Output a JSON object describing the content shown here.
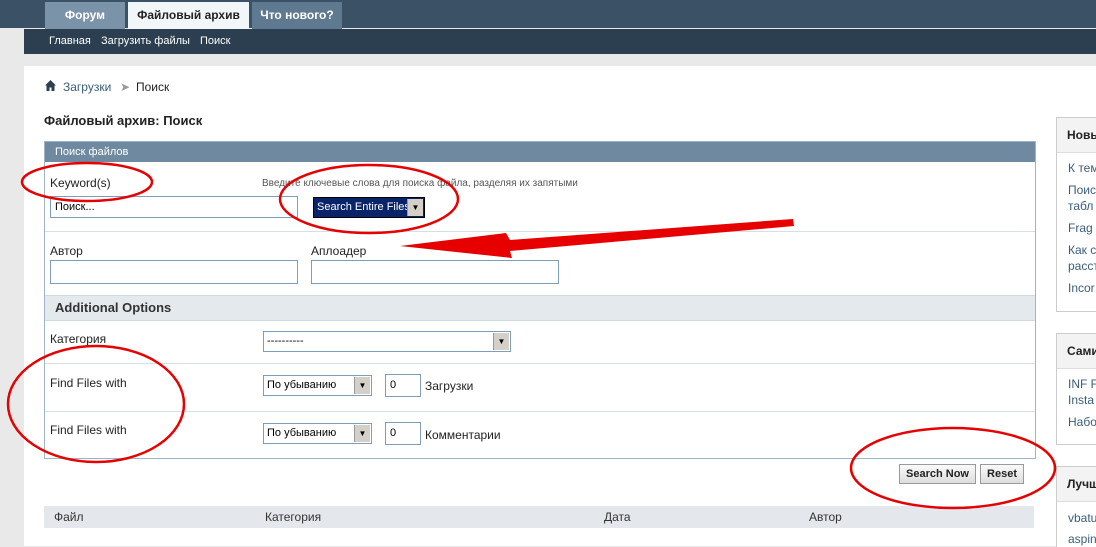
{
  "nav": {
    "tabs": [
      "Форум",
      "Файловый архив",
      "Что нового?"
    ],
    "sub_links": [
      "Главная",
      "Загрузить файлы",
      "Поиск"
    ]
  },
  "breadcrumb": {
    "items": [
      "Загрузки",
      "Поиск"
    ]
  },
  "page_title": "Файловый архив: Поиск",
  "panel": {
    "title": "Поиск файлов",
    "keywords_label": "Keyword(s)",
    "keywords_hint": "Введите ключевые слова для поиска файла, разделяя их запятыми",
    "keywords_value": "Поиск...",
    "search_scope": "Search Entire Files",
    "author_label": "Автор",
    "uploader_label": "Аплоадер",
    "additional_options": "Additional Options",
    "category_label": "Категория",
    "category_value": "----------",
    "downloads_filter": {
      "label": "Find Files with",
      "order": "По убыванию",
      "count": "0",
      "unit": "Загрузки"
    },
    "comments_filter": {
      "label": "Find Files with",
      "order": "По убыванию",
      "count": "0",
      "unit": "Комментарии"
    }
  },
  "buttons": {
    "search": "Search Now",
    "reset": "Reset"
  },
  "results_table": {
    "columns": [
      "Файл",
      "Категория",
      "Дата",
      "Автор"
    ]
  },
  "sidebar": {
    "block1": {
      "title": "Новы",
      "items": [
        "К тем",
        "Поис",
        "табл",
        "Frag",
        "Как с",
        "расст",
        "Incor"
      ]
    },
    "block2": {
      "title": "Сами",
      "items": [
        "INF F",
        "Insta",
        "Набо"
      ]
    },
    "block3": {
      "title": "Лучш",
      "items": [
        "vbatu",
        "aspin"
      ]
    }
  },
  "colors": {
    "nav_bg": "#3b5266",
    "panel_header": "#6f8aa0",
    "link": "#3b5d7a",
    "annotation": "#e60000"
  }
}
